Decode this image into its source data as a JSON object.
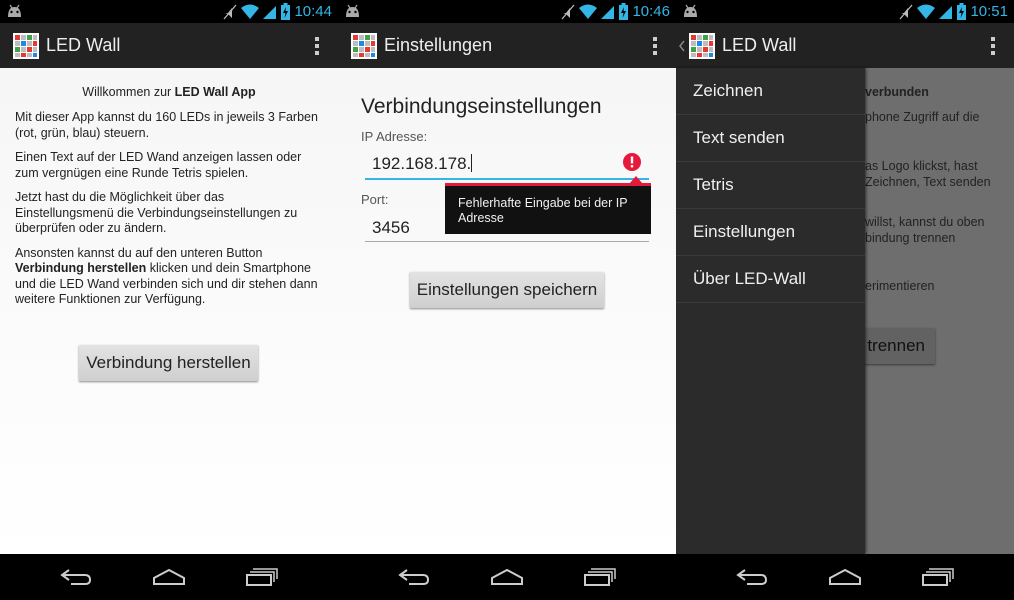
{
  "screens": [
    {
      "status": {
        "time": "10:44"
      },
      "actionbar": {
        "title": "LED Wall",
        "overflow_icon": "overflow-menu-icon"
      },
      "welcome": {
        "prefix": "Willkommen zur ",
        "app_name": "LED Wall App"
      },
      "paragraphs": {
        "p1": "Mit dieser App kannst du 160 LEDs in jeweils 3 Farben (rot, grün, blau) steuern.",
        "p2": "Einen Text auf der LED Wand anzeigen lassen oder zum vergnügen eine Runde Tetris spielen.",
        "p3": "Jetzt hast du die Möglichkeit über das Einstellungsmenü die Verbindungseinstellungen zu überprüfen oder zu ändern.",
        "p4_prefix": "Ansonsten kannst du auf den unteren Button ",
        "p4_bold": "Verbindung herstellen",
        "p4_suffix": " klicken und dein Smartphone und die LED Wand verbinden sich und dir stehen dann weitere Funktionen zur Verfügung."
      },
      "connect_button": "Verbindung herstellen"
    },
    {
      "status": {
        "time": "10:46"
      },
      "actionbar": {
        "title": "Einstellungen"
      },
      "heading": "Verbindungseinstellungen",
      "ip": {
        "label": "IP Adresse:",
        "value": "192.168.178."
      },
      "port": {
        "label": "Port:",
        "value": "3456"
      },
      "error_tooltip": "Fehlerhafte Eingabe bei der IP Adresse",
      "save_button": "Einstellungen speichern"
    },
    {
      "status": {
        "time": "10:51"
      },
      "actionbar": {
        "title": "LED Wall"
      },
      "drawer": {
        "items": [
          "Zeichnen",
          "Text senden",
          "Tetris",
          "Einstellungen",
          "Über LED-Wall"
        ]
      },
      "behind": {
        "t1": "verbunden",
        "t2": "phone Zugriff auf die",
        "t3": "as Logo klickst, hast",
        "t4": "Zeichnen, Text senden",
        "t5": "willst, kannst du oben",
        "t6": "bindung trennen",
        "t7": "erimentieren",
        "button": "trennen"
      }
    }
  ],
  "colors": {
    "accent": "#33b5e5",
    "error": "#e5193b",
    "actionbar": "#222222",
    "drawer": "#2b2b2b"
  }
}
